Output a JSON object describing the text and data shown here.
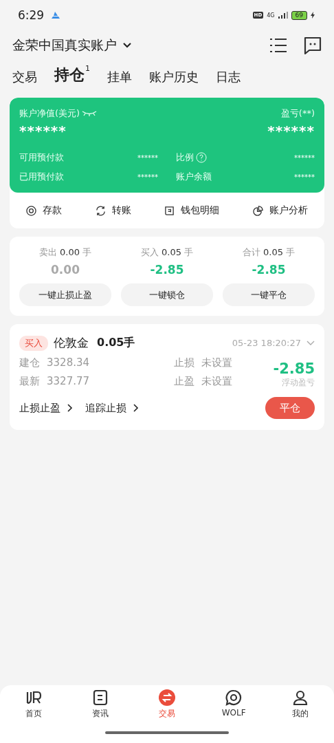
{
  "status_bar": {
    "time": "6:29",
    "hd": "HD",
    "network": "4G",
    "battery": "69"
  },
  "header": {
    "account": "金荣中国真实账户"
  },
  "tabs": [
    {
      "label": "交易",
      "selected": false
    },
    {
      "label": "持仓",
      "selected": true,
      "badge": "1"
    },
    {
      "label": "挂单",
      "selected": false
    },
    {
      "label": "账户历史",
      "selected": false
    },
    {
      "label": "日志",
      "selected": false
    }
  ],
  "account_card": {
    "equity_label": "账户净值(美元)",
    "equity_value": "******",
    "pnl_label": "盈亏(**)",
    "pnl_value": "******",
    "rows": [
      {
        "label": "可用预付款",
        "value": "******",
        "help": false
      },
      {
        "label": "比例",
        "value": "******",
        "help": true
      },
      {
        "label": "已用预付款",
        "value": "******",
        "help": false
      },
      {
        "label": "账户余额",
        "value": "******",
        "help": false
      }
    ]
  },
  "actions": [
    {
      "kind": "deposit",
      "label": "存款"
    },
    {
      "kind": "transfer",
      "label": "转账"
    },
    {
      "kind": "wallet",
      "label": "钱包明细"
    },
    {
      "kind": "analysis",
      "label": "账户分析"
    }
  ],
  "summary": [
    {
      "label": "卖出",
      "lots": "0.00",
      "unit": "手",
      "value": "0.00",
      "color": "#aaaaaa",
      "button": "一键止损止盈"
    },
    {
      "label": "买入",
      "lots": "0.05",
      "unit": "手",
      "value": "-2.85",
      "color": "#1fbf83",
      "button": "一键锁仓"
    },
    {
      "label": "合计",
      "lots": "0.05",
      "unit": "手",
      "value": "-2.85",
      "color": "#1fbf83",
      "button": "一键平仓"
    }
  ],
  "positions": [
    {
      "side": "买入",
      "symbol": "伦敦金",
      "lots": "0.05手",
      "time": "05-23 18:20:27",
      "fields": [
        {
          "label": "建仓",
          "value": "3328.34"
        },
        {
          "label": "止损",
          "value": "未设置"
        },
        {
          "label": "最新",
          "value": "3327.77"
        },
        {
          "label": "止盈",
          "value": "未设置"
        }
      ],
      "pnl": "-2.85",
      "color": "#1fbf83",
      "pnl_label": "浮动盈亏",
      "links": [
        "止损止盈",
        "追踪止损"
      ],
      "close": "平仓"
    }
  ],
  "nav": [
    {
      "kind": "home",
      "label": "首页",
      "selected": false
    },
    {
      "kind": "news",
      "label": "资讯",
      "selected": false
    },
    {
      "kind": "trade",
      "label": "交易",
      "selected": true
    },
    {
      "kind": "chat",
      "label": "WOLF",
      "selected": false
    },
    {
      "kind": "user",
      "label": "我的",
      "selected": false
    }
  ]
}
